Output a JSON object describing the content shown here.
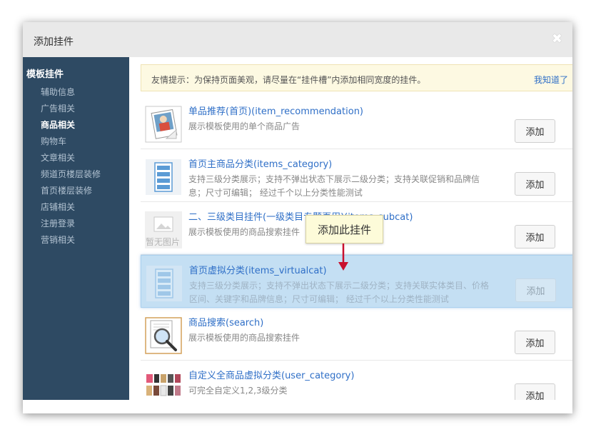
{
  "dialog": {
    "title": "添加挂件",
    "close_icon": "close-icon"
  },
  "sidebar": {
    "heading": "模板挂件",
    "items": [
      {
        "label": "辅助信息",
        "active": false
      },
      {
        "label": "广告相关",
        "active": false
      },
      {
        "label": "商品相关",
        "active": true
      },
      {
        "label": "购物车",
        "active": false
      },
      {
        "label": "文章相关",
        "active": false
      },
      {
        "label": "频道页楼层装修",
        "active": false
      },
      {
        "label": "首页楼层装修",
        "active": false
      },
      {
        "label": "店铺相关",
        "active": false
      },
      {
        "label": "注册登录",
        "active": false
      },
      {
        "label": "营销相关",
        "active": false
      }
    ]
  },
  "notice": {
    "text": "友情提示：为保持页面美观，请尽量在“挂件槽”内添加相同宽度的挂件。",
    "link": "我知道了"
  },
  "widgets": [
    {
      "name": "单品推荐(首页)(item_recommendation)",
      "desc": "展示模板使用的单个商品广告",
      "button": "添加",
      "icon": "product-photo-icon"
    },
    {
      "name": "首页主商品分类(items_category)",
      "desc": "支持三级分类展示；支持不弹出状态下展示二级分类；支持关联促销和品牌信息；尺寸可编辑； 经过千个以上分类性能测试",
      "button": "添加",
      "icon": "category-list-icon"
    },
    {
      "name": "二、三级类目挂件(一级类目专题页用)(items_subcat)",
      "desc": "展示模板使用的商品搜索挂件",
      "button": "添加",
      "icon": "no-image-icon",
      "icon_text": "暂无图片"
    },
    {
      "name": "首页虚拟分类(items_virtualcat)",
      "desc": "支持三级分类展示；支持不弹出状态下展示二级分类；支持关联实体类目、价格区间、关键字和品牌信息；尺寸可编辑； 经过千个以上分类性能测试",
      "button": "添加",
      "icon": "category-list-icon"
    },
    {
      "name": "商品搜索(search)",
      "desc": "展示模板使用的商品搜索挂件",
      "button": "添加",
      "icon": "magnifier-icon"
    },
    {
      "name": "自定义全商品虚拟分类(user_category)",
      "desc": "可完全自定义1,2,3级分类",
      "button": "添加",
      "icon": "product-grid-icon"
    }
  ],
  "tooltip": {
    "text": "添加此挂件"
  },
  "colors": {
    "sidebar_bg": "#2e4a63",
    "link_blue": "#2f6fc7",
    "highlight_bg": "#c4dff3",
    "arrow_red": "#c8102e"
  }
}
